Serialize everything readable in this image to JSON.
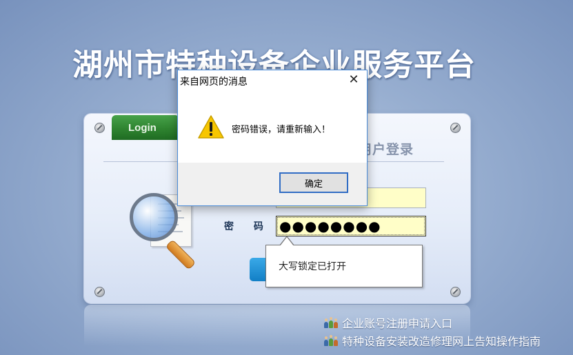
{
  "page": {
    "title": "湖州市特种设备企业服务平台"
  },
  "login_panel": {
    "tab_label": "Login",
    "heading": "用户登录",
    "password_label": "密 码",
    "password_value": "●●●●●●●●",
    "username_value": ""
  },
  "tooltip": {
    "text": "大写锁定已打开"
  },
  "footer_links": [
    {
      "label": "企业账号注册申请入口",
      "icon": "people-icon"
    },
    {
      "label": "特种设备安装改造修理网上告知操作指南",
      "icon": "people-icon"
    }
  ],
  "dialog": {
    "title": "来自网页的消息",
    "close_glyph": "✕",
    "message": "密码错误，请重新输入！",
    "ok_label": "确定",
    "icon": "warning-icon"
  },
  "colors": {
    "background": "#97aed0",
    "login_tab": "#2f8430",
    "input_fill": "#fffec8",
    "warning": "#f7c600",
    "dialog_border": "#4a8bd8"
  }
}
